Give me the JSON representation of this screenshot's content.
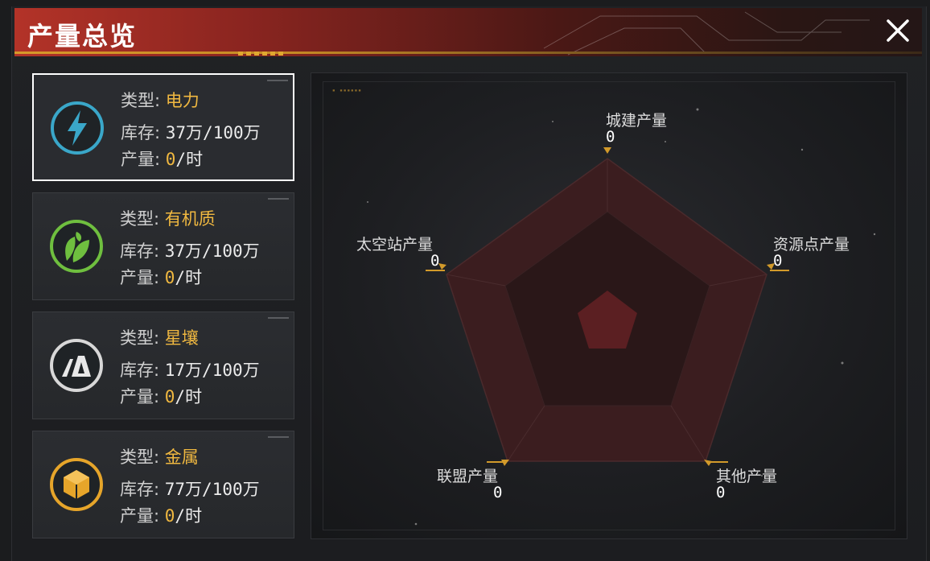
{
  "header": {
    "title": "产量总览"
  },
  "labels": {
    "type": "类型:",
    "stock": "库存:",
    "output": "产量:"
  },
  "resources": [
    {
      "type": "电力",
      "stock": "37万/100万",
      "output_value": "0",
      "output_unit": "/时",
      "icon": "lightning-icon",
      "color": "#3aa7c9",
      "selected": true
    },
    {
      "type": "有机质",
      "stock": "37万/100万",
      "output_value": "0",
      "output_unit": "/时",
      "icon": "leaf-icon",
      "color": "#6fbf3f",
      "selected": false
    },
    {
      "type": "星壤",
      "stock": "17万/100万",
      "output_value": "0",
      "output_unit": "/时",
      "icon": "soil-icon",
      "color": "#d8d8d8",
      "selected": false
    },
    {
      "type": "金属",
      "stock": "77万/100万",
      "output_value": "0",
      "output_unit": "/时",
      "icon": "metal-cube-icon",
      "color": "#e6a52a",
      "selected": false
    }
  ],
  "radar": {
    "axes": [
      {
        "label": "城建产量",
        "value": "0"
      },
      {
        "label": "资源点产量",
        "value": "0"
      },
      {
        "label": "其他产量",
        "value": "0"
      },
      {
        "label": "联盟产量",
        "value": "0"
      },
      {
        "label": "太空站产量",
        "value": "0"
      }
    ],
    "values": [
      0,
      0,
      0,
      0,
      0
    ],
    "fill_colors": [
      "#3b1d1f",
      "#2a1718",
      "#5b1f22"
    ],
    "accent": "#d29a2a"
  },
  "colors": {
    "header_red": "#b33328",
    "accent_gold": "#f0b840"
  }
}
